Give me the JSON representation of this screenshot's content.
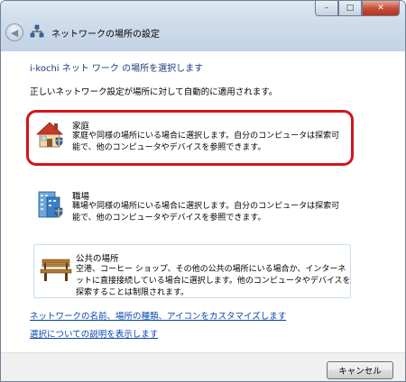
{
  "window": {
    "title": "ネットワークの場所の設定",
    "buttons": {
      "minimize": "–",
      "maximize": "□",
      "close": "✕"
    }
  },
  "main": {
    "heading": "i-kochi ネット ワーク の場所を選択します",
    "subtext": "正しいネットワーク設定が場所に対して自動的に適用されます。",
    "options": [
      {
        "title": "家庭",
        "description": "家庭や同様の場所にいる場合に選択します。自分のコンピュータは探索可能で、他のコンピュータやデバイスを参照できます。",
        "icon": "house-icon"
      },
      {
        "title": "職場",
        "description": "職場や同様の場所にいる場合に選択します。自分のコンピュータは探索可能で、他のコンピュータやデバイスを参照できます。",
        "icon": "office-building-icon"
      },
      {
        "title": "公共の場所",
        "description": "空港、コーヒー ショップ、その他の公共の場所にいる場合か、インターネットに直接接続している場合に選択します。他のコンピュータやデバイスを探索することは制限されます。",
        "icon": "park-bench-icon"
      }
    ],
    "links": [
      "ネットワークの名前、場所の種類、アイコンをカスタマイズします",
      "選択についての説明を表示します"
    ]
  },
  "footer": {
    "cancel_label": "キャンセル"
  },
  "colors": {
    "highlight": "#d3141e",
    "heading": "#1e3c78",
    "link": "#0645ad"
  }
}
